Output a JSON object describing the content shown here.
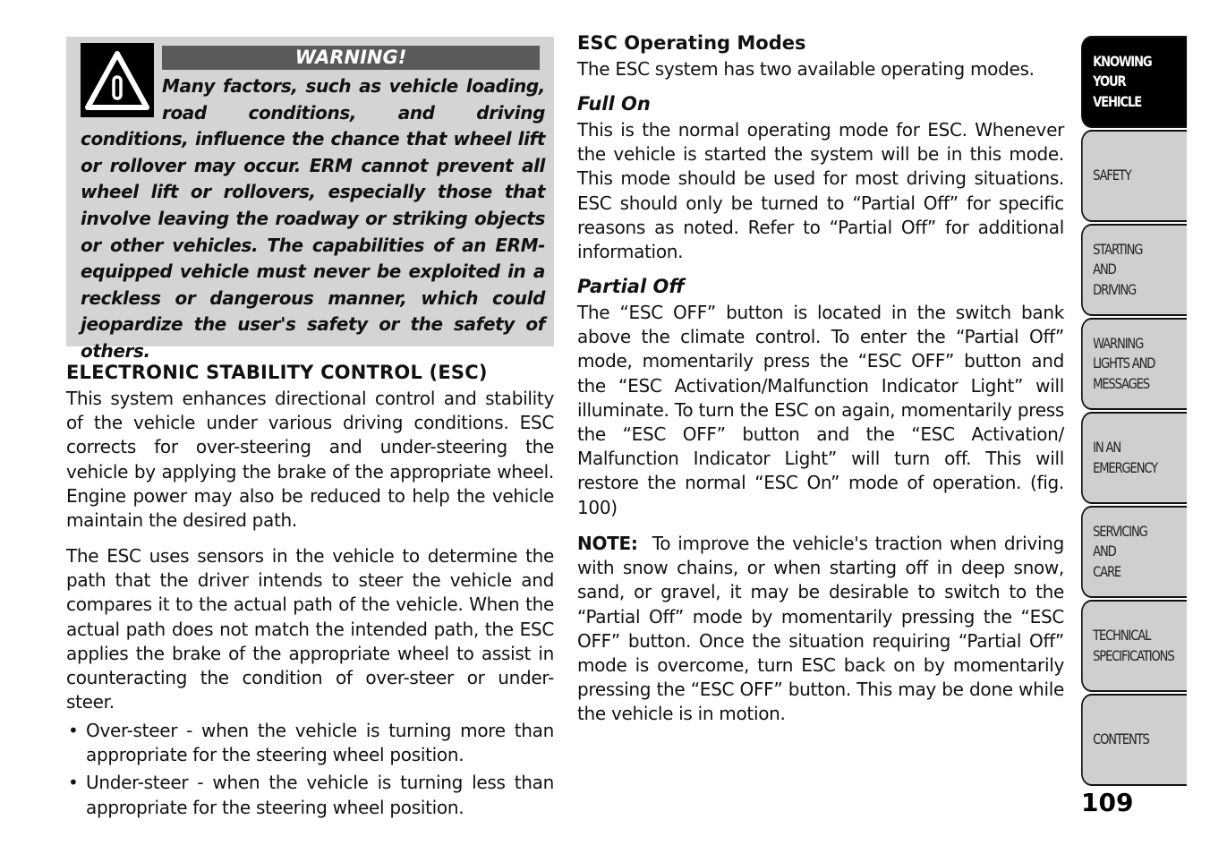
{
  "warning": {
    "icon": "warning-triangle-icon",
    "title": "WARNING!",
    "text": "Many factors, such as vehicle loading, road conditions, and driving conditions, influence the chance that wheel lift or rollover may occur. ERM cannot prevent all wheel lift or rollovers, especially those that involve leaving the roadway or striking objects or other vehicles. The capabilities of an ERM-equipped vehicle must never be exploited in a reckless or dangerous manner, which could jeopardize the user's safety or the safety of others."
  },
  "left": {
    "heading": "ELECTRONIC STABILITY CONTROL (ESC)",
    "p1": "This system enhances directional control and stability of the vehicle under various driving conditions. ESC corrects for over-steering and under-steering the vehicle by applying the brake of the appropriate wheel. Engine power may also be reduced to help the vehicle maintain the desired path.",
    "p2": "The ESC uses sensors in the vehicle to determine the path that the driver intends to steer the vehicle and compares it to the actual path of the vehicle. When the actual path does not match the intended path, the ESC applies the brake of the appropriate wheel to assist in counteracting the condition of over-steer or under-steer.",
    "bullets": [
      "Over-steer - when the vehicle is turning more than appropriate for the steering wheel position.",
      "Under-steer - when the vehicle is turning less than appropriate for the steering wheel position."
    ]
  },
  "right": {
    "modes_heading": "ESC Operating Modes",
    "modes_text": "The ESC system has two available operating modes.",
    "full_on_heading": "Full On",
    "full_on_text": "This is the normal operating mode for ESC. Whenever the vehicle is started the system will be in this mode. This mode should be used for most driving situations. ESC should only be turned to “Partial Off” for specific reasons as noted. Refer to “Partial Off” for additional information.",
    "partial_off_heading": "Partial Off",
    "partial_off_text": "The “ESC OFF” button is located in the switch bank above the climate control. To enter the “Partial Off” mode, momentarily press the “ESC OFF” button and the “ESC Activation/Malfunction Indicator Light” will illuminate. To turn the ESC on again, momentarily press the “ESC OFF” button and the “ESC Activation/ Malfunction Indicator Light” will turn off. This will restore the normal “ESC On” mode of operation. (fig. 100)",
    "note_label": "NOTE:",
    "note_text": "To improve the vehicle's traction when driving with snow chains, or when starting off in deep snow, sand, or gravel, it may be desirable to switch to the “Partial Off” mode by momentarily pressing the “ESC OFF” button. Once the situation requiring “Partial Off” mode is overcome, turn ESC back on by momentarily pressing the “ESC OFF” button. This may be done while the vehicle is in motion."
  },
  "tabs": [
    {
      "label": "KNOWING\nYOUR\nVEHICLE",
      "active": true
    },
    {
      "label": "SAFETY",
      "active": false
    },
    {
      "label": "STARTING\nAND\nDRIVING",
      "active": false
    },
    {
      "label": "WARNING\nLIGHTS AND\nMESSAGES",
      "active": false
    },
    {
      "label": "IN AN\nEMERGENCY",
      "active": false
    },
    {
      "label": "SERVICING\nAND\nCARE",
      "active": false
    },
    {
      "label": "TECHNICAL\nSPECIFICATIONS",
      "active": false
    },
    {
      "label": "CONTENTS",
      "active": false
    }
  ],
  "page_number": "109",
  "colors": {
    "warning_bg": "#d4d4d4",
    "warning_title_bg": "#5a5a5a",
    "tab_bg": "#cfcfcf",
    "tab_active_bg": "#000000"
  }
}
